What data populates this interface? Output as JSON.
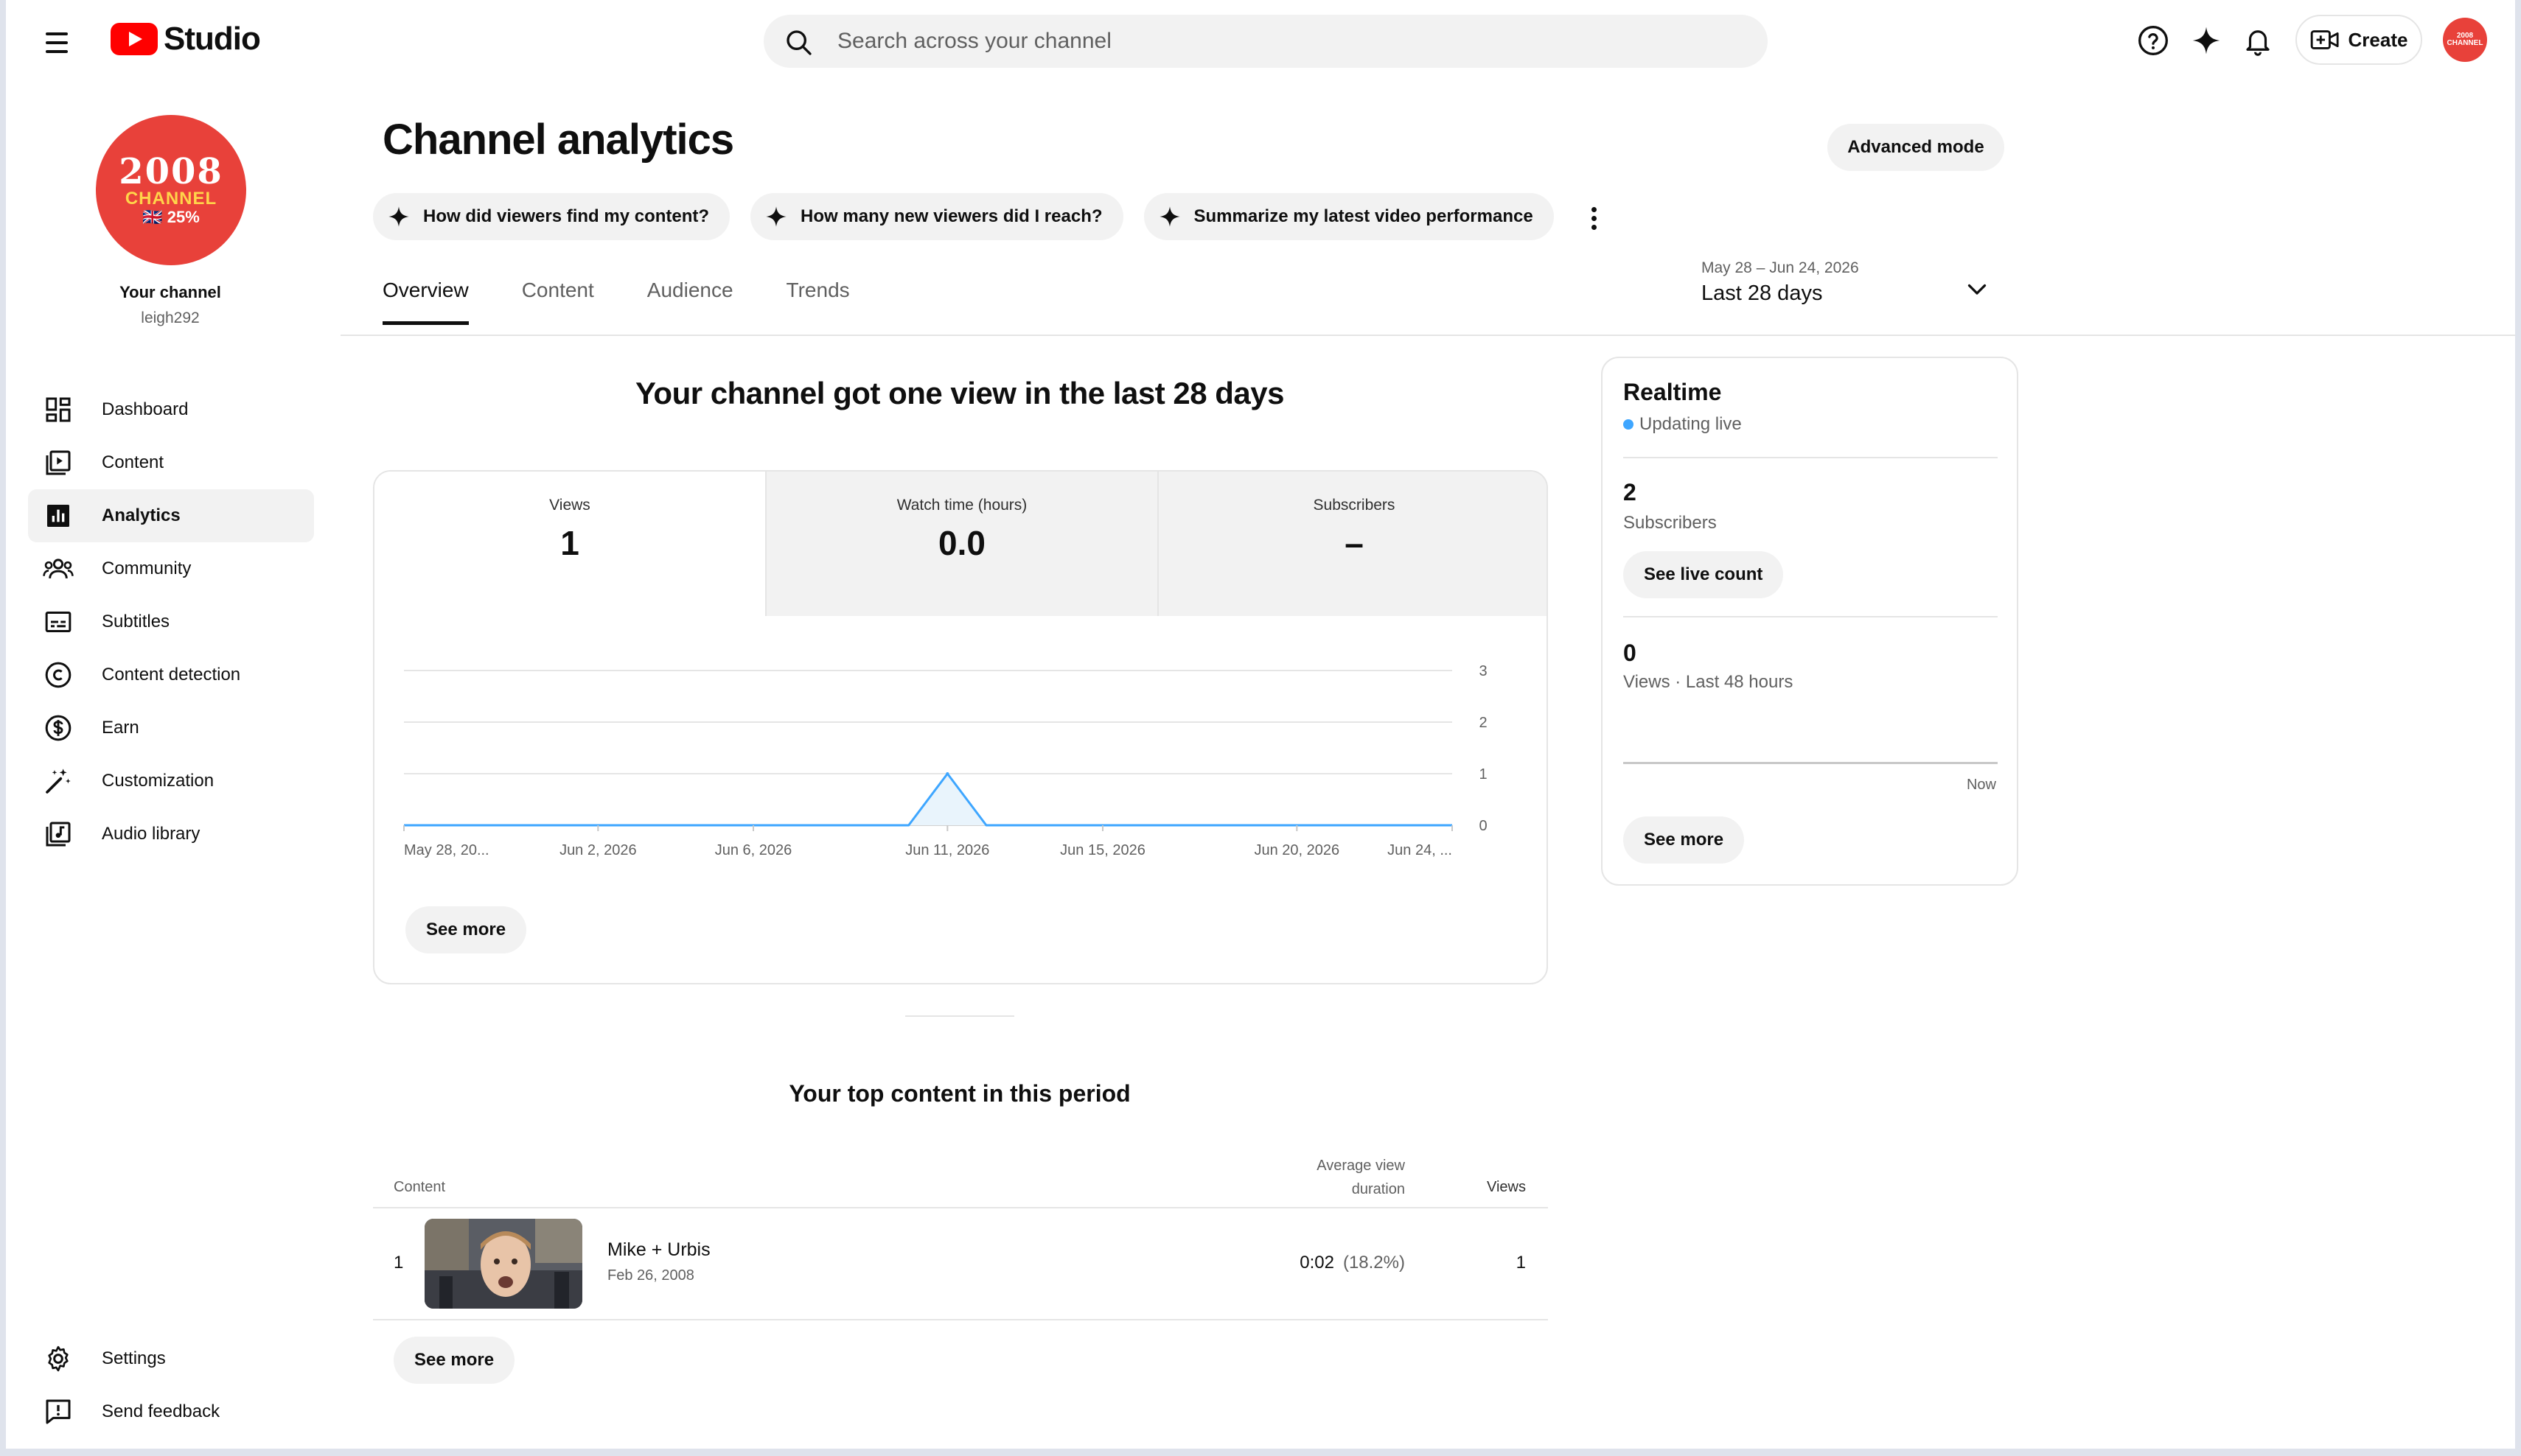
{
  "app": {
    "brand": "Studio",
    "search_placeholder": "Search across your channel",
    "create_label": "Create",
    "avatar_text": "2008 CHANNEL"
  },
  "sidebar": {
    "channel_avatar_line1": "2008",
    "channel_avatar_line2": "CHANNEL",
    "channel_avatar_line3": "🇬🇧 25%",
    "channel_label": "Your channel",
    "channel_handle": "leigh292",
    "items": [
      {
        "label": "Dashboard",
        "icon": "dashboard-icon"
      },
      {
        "label": "Content",
        "icon": "content-icon"
      },
      {
        "label": "Analytics",
        "icon": "analytics-icon",
        "active": true
      },
      {
        "label": "Community",
        "icon": "community-icon"
      },
      {
        "label": "Subtitles",
        "icon": "subtitles-icon"
      },
      {
        "label": "Content detection",
        "icon": "copyright-icon"
      },
      {
        "label": "Earn",
        "icon": "dollar-icon"
      },
      {
        "label": "Customization",
        "icon": "magic-wand-icon"
      },
      {
        "label": "Audio library",
        "icon": "audio-library-icon"
      }
    ],
    "bottom_items": [
      {
        "label": "Settings",
        "icon": "gear-icon"
      },
      {
        "label": "Send feedback",
        "icon": "feedback-icon"
      }
    ]
  },
  "main": {
    "title": "Channel analytics",
    "advanced_mode_label": "Advanced mode",
    "chips": [
      "How did viewers find my content?",
      "How many new viewers did I reach?",
      "Summarize my latest video performance"
    ],
    "tabs": [
      "Overview",
      "Content",
      "Audience",
      "Trends"
    ],
    "active_tab": "Overview",
    "date_range_dates": "May 28 – Jun 24, 2026",
    "date_range_label": "Last 28 days",
    "headline": "Your channel got one view in the last 28 days",
    "metrics": [
      {
        "label": "Views",
        "value": "1"
      },
      {
        "label": "Watch time (hours)",
        "value": "0.0"
      },
      {
        "label": "Subscribers",
        "value": "–"
      }
    ],
    "see_more_label": "See more",
    "top_content_title": "Your top content in this period",
    "table": {
      "col_content": "Content",
      "col_avg": "Average view duration",
      "col_avg_line1": "Average view",
      "col_avg_line2": "duration",
      "col_views": "Views",
      "rows": [
        {
          "rank": "1",
          "title": "Mike + Urbis",
          "date": "Feb 26, 2008",
          "avg": "0:02",
          "avg_pct": "(18.2%)",
          "views": "1"
        }
      ]
    }
  },
  "realtime": {
    "title": "Realtime",
    "status": "Updating live",
    "subscribers_value": "2",
    "subscribers_label": "Subscribers",
    "see_live_count_label": "See live count",
    "views_value": "0",
    "views_label": "Views · Last 48 hours",
    "now_label": "Now",
    "see_more_label": "See more"
  },
  "chart_data": {
    "type": "area",
    "title": "",
    "xlabel": "",
    "ylabel": "",
    "x_tick_labels": [
      "May 28, 20...",
      "Jun 2, 2026",
      "Jun 6, 2026",
      "Jun 11, 2026",
      "Jun 15, 2026",
      "Jun 20, 2026",
      "Jun 24, ..."
    ],
    "y_ticks": [
      0,
      1,
      2,
      3
    ],
    "ylim": [
      0,
      3
    ],
    "x": [
      "2026-05-28",
      "2026-05-29",
      "2026-05-30",
      "2026-05-31",
      "2026-06-01",
      "2026-06-02",
      "2026-06-03",
      "2026-06-04",
      "2026-06-05",
      "2026-06-06",
      "2026-06-07",
      "2026-06-08",
      "2026-06-09",
      "2026-06-10",
      "2026-06-11",
      "2026-06-12",
      "2026-06-13",
      "2026-06-14",
      "2026-06-15",
      "2026-06-16",
      "2026-06-17",
      "2026-06-18",
      "2026-06-19",
      "2026-06-20",
      "2026-06-21",
      "2026-06-22",
      "2026-06-23",
      "2026-06-24"
    ],
    "series": [
      {
        "values": [
          0,
          0,
          0,
          0,
          0,
          0,
          0,
          0,
          0,
          0,
          0,
          0,
          0,
          0,
          1,
          0,
          0,
          0,
          0,
          0,
          0,
          0,
          0,
          0,
          0,
          0,
          0,
          0
        ]
      }
    ],
    "grid": true,
    "y_axis_side": "right",
    "line_color": "#3ea6ff",
    "fill_color": "#e9f4fc"
  }
}
